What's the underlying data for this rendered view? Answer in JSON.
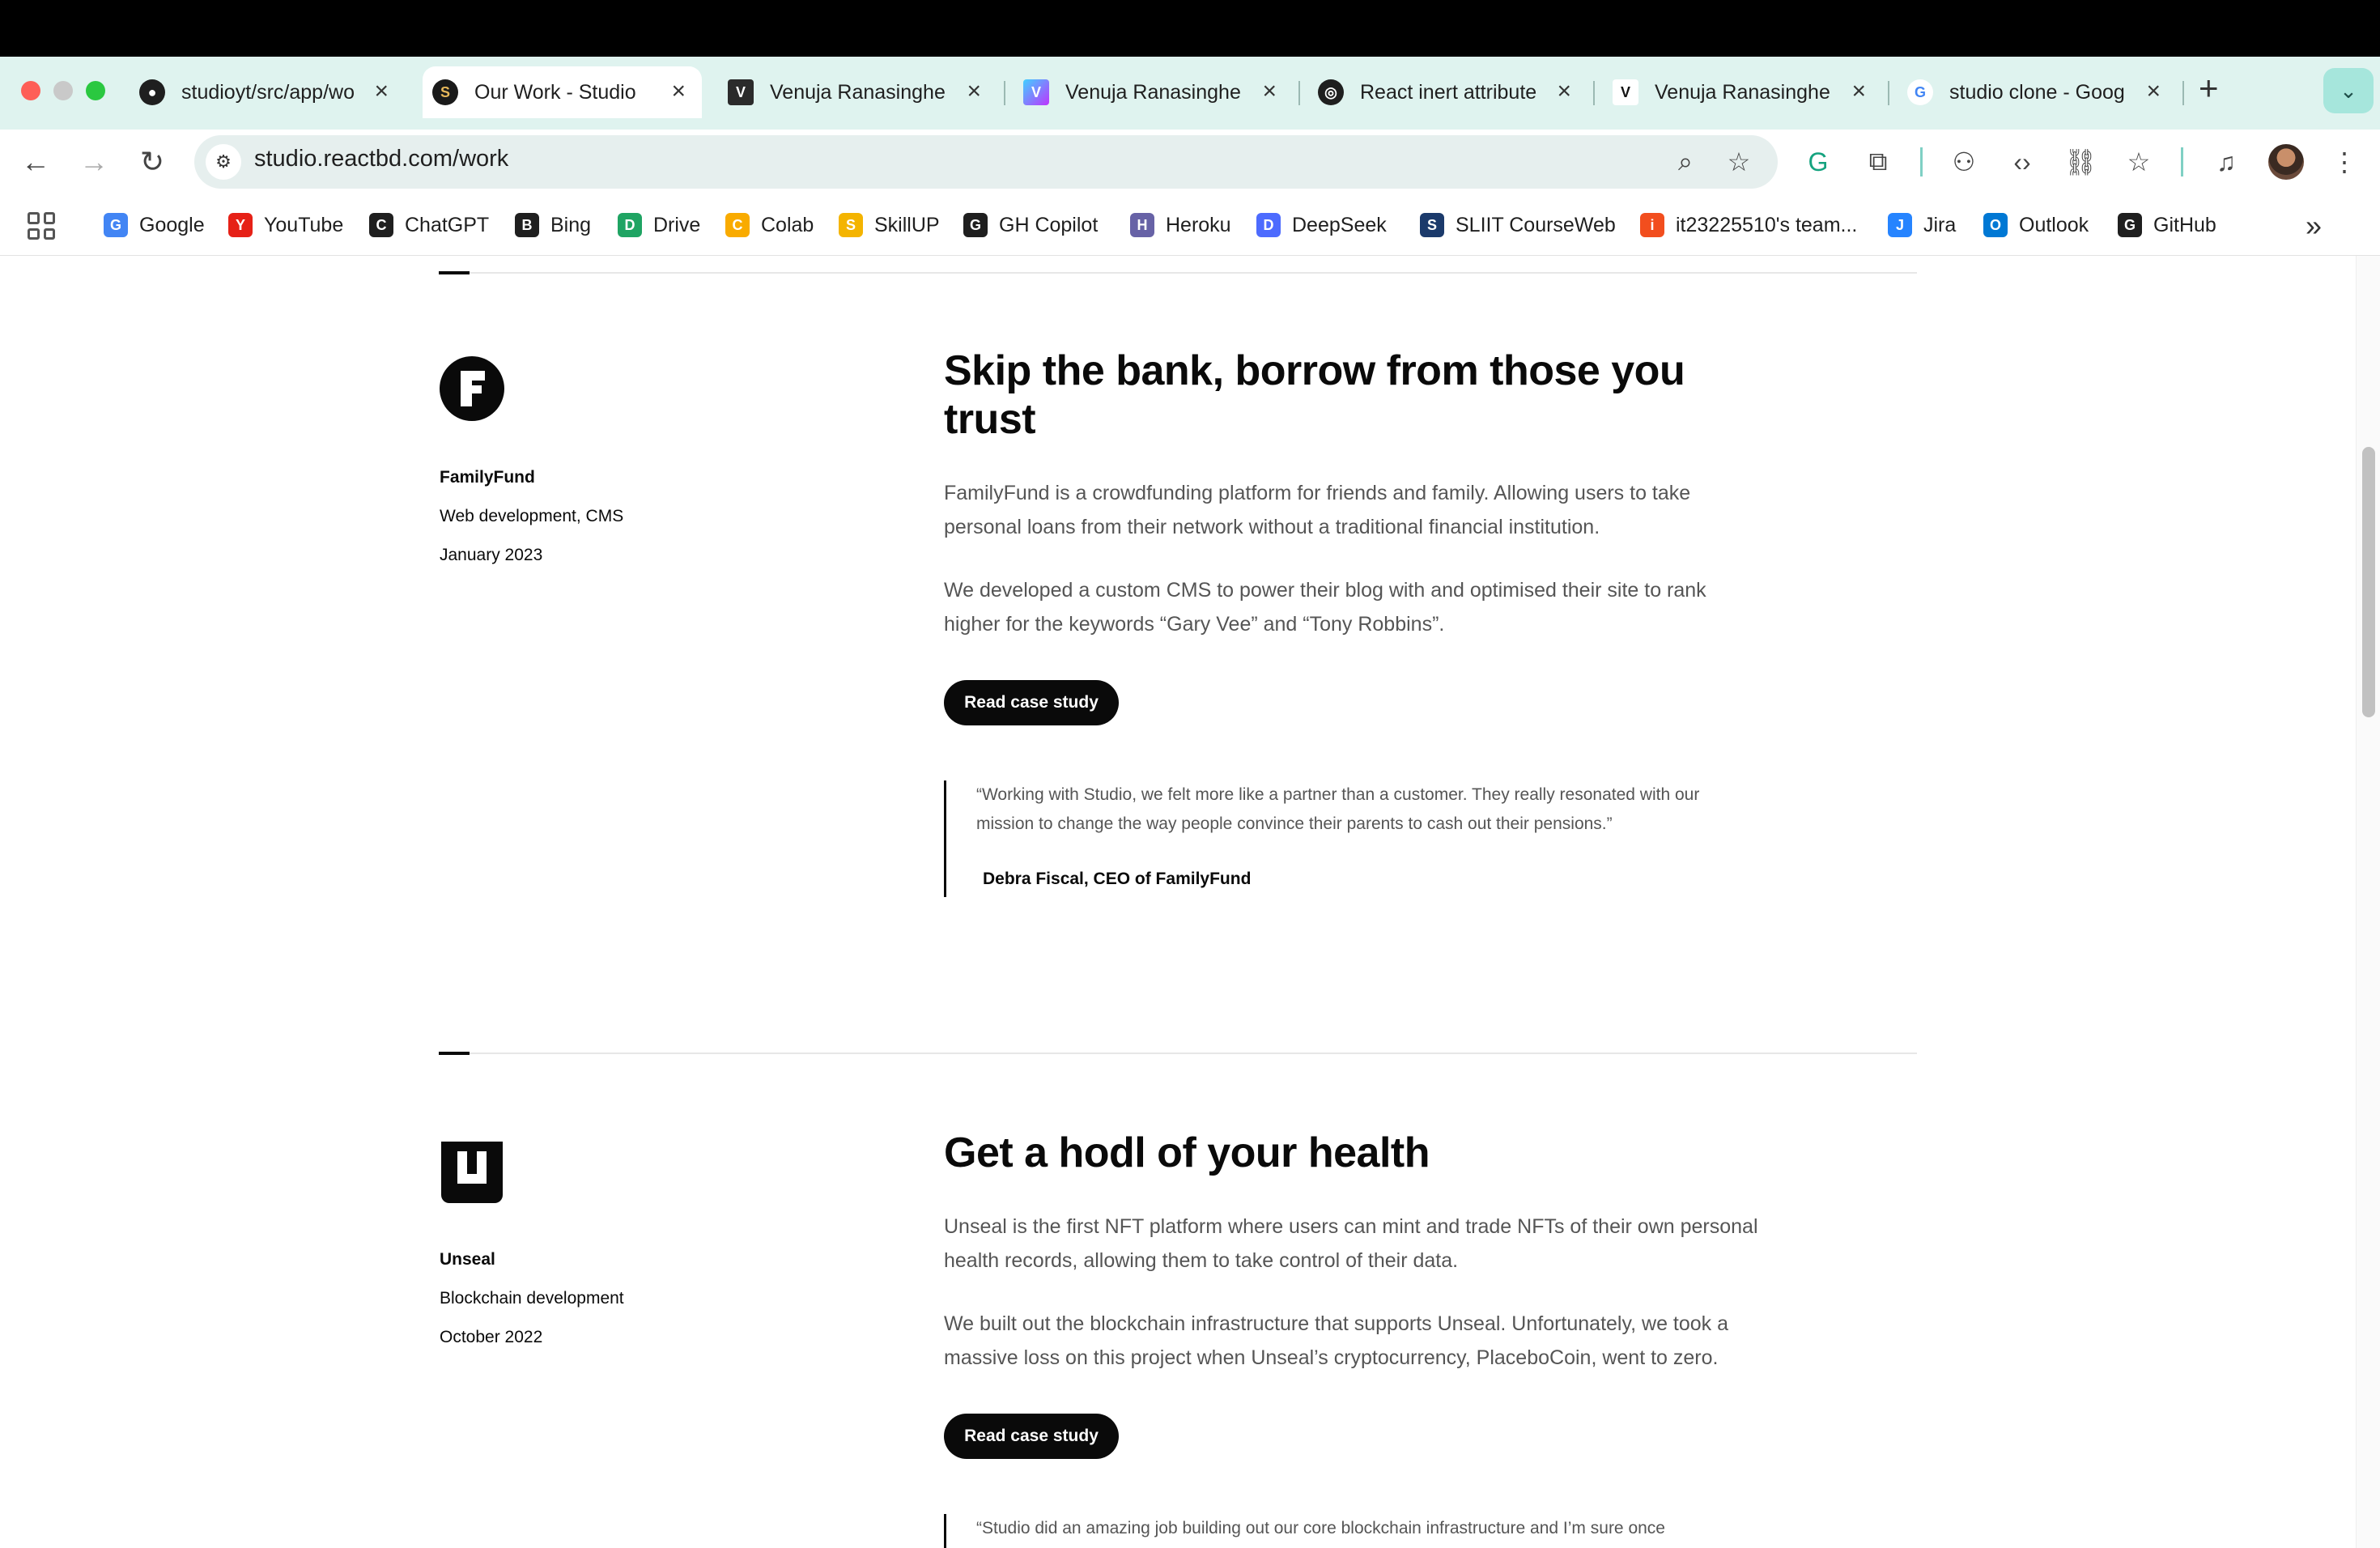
{
  "browser": {
    "tabs": [
      {
        "title": "studioyt/src/app/wo",
        "favicon": "github-icon",
        "active": false
      },
      {
        "title": "Our Work - Studio",
        "favicon": "studio-icon",
        "active": true
      },
      {
        "title": "Venuja Ranasinghe",
        "favicon": "v-icon",
        "active": false
      },
      {
        "title": "Venuja Ranasinghe",
        "favicon": "vite-icon",
        "active": false
      },
      {
        "title": "React inert attribute",
        "favicon": "openai-icon",
        "active": false
      },
      {
        "title": "Venuja Ranasinghe",
        "favicon": "v-icon",
        "active": false
      },
      {
        "title": "studio clone - Goog",
        "favicon": "google-icon",
        "active": false
      }
    ],
    "url": "studio.reactbd.com/work",
    "bookmarks": [
      {
        "label": "Google",
        "icon": "google-icon",
        "color": "#4285f4"
      },
      {
        "label": "YouTube",
        "icon": "youtube-icon",
        "color": "#e62117"
      },
      {
        "label": "ChatGPT",
        "icon": "openai-icon",
        "color": "#1f1f1f"
      },
      {
        "label": "Bing",
        "icon": "search-icon",
        "color": "#1f1f1f"
      },
      {
        "label": "Drive",
        "icon": "drive-icon",
        "color": "#1fa463"
      },
      {
        "label": "Colab",
        "icon": "colab-icon",
        "color": "#f9ab00"
      },
      {
        "label": "SkillUP",
        "icon": "skillup-icon",
        "color": "#f4b400"
      },
      {
        "label": "GH Copilot",
        "icon": "copilot-icon",
        "color": "#1f1f1f"
      },
      {
        "label": "Heroku",
        "icon": "heroku-icon",
        "color": "#6762a6"
      },
      {
        "label": "DeepSeek",
        "icon": "deepseek-icon",
        "color": "#4d6bfe"
      },
      {
        "label": "SLIIT CourseWeb",
        "icon": "sliit-icon",
        "color": "#1b3a6b"
      },
      {
        "label": "it23225510's team...",
        "icon": "figma-icon",
        "color": "#f24e1e"
      },
      {
        "label": "Jira",
        "icon": "jira-icon",
        "color": "#2684ff"
      },
      {
        "label": "Outlook",
        "icon": "outlook-icon",
        "color": "#0078d4"
      },
      {
        "label": "GitHub",
        "icon": "github-icon",
        "color": "#1f1f1f"
      }
    ]
  },
  "projects": [
    {
      "client": "FamilyFund",
      "service": "Web development, CMS",
      "date": "January 2023",
      "headline": "Skip the bank, borrow from those you trust",
      "paragraphs": [
        "FamilyFund is a crowdfunding platform for friends and family. Allowing users to take personal loans from their network without a traditional financial institution.",
        "We developed a custom CMS to power their blog with and optimised their site to rank higher for the keywords “Gary Vee” and “Tony Robbins”."
      ],
      "cta": "Read case study",
      "quote": "“Working with Studio, we felt more like a partner than a customer. They really resonated with our mission to change the way people convince their parents to cash out their pensions.”",
      "quote_author": "Debra Fiscal, CEO of FamilyFund"
    },
    {
      "client": "Unseal",
      "service": "Blockchain development",
      "date": "October 2022",
      "headline": "Get a hodl of your health",
      "paragraphs": [
        "Unseal is the first NFT platform where users can mint and trade NFTs of their own personal health records, allowing them to take control of their data.",
        "We built out the blockchain infrastructure that supports Unseal. Unfortunately, we took a massive loss on this project when Unseal’s cryptocurrency, PlaceboCoin, went to zero."
      ],
      "cta": "Read case study",
      "quote": "“Studio did an amazing job building out our core blockchain infrastructure and I’m sure once"
    }
  ]
}
